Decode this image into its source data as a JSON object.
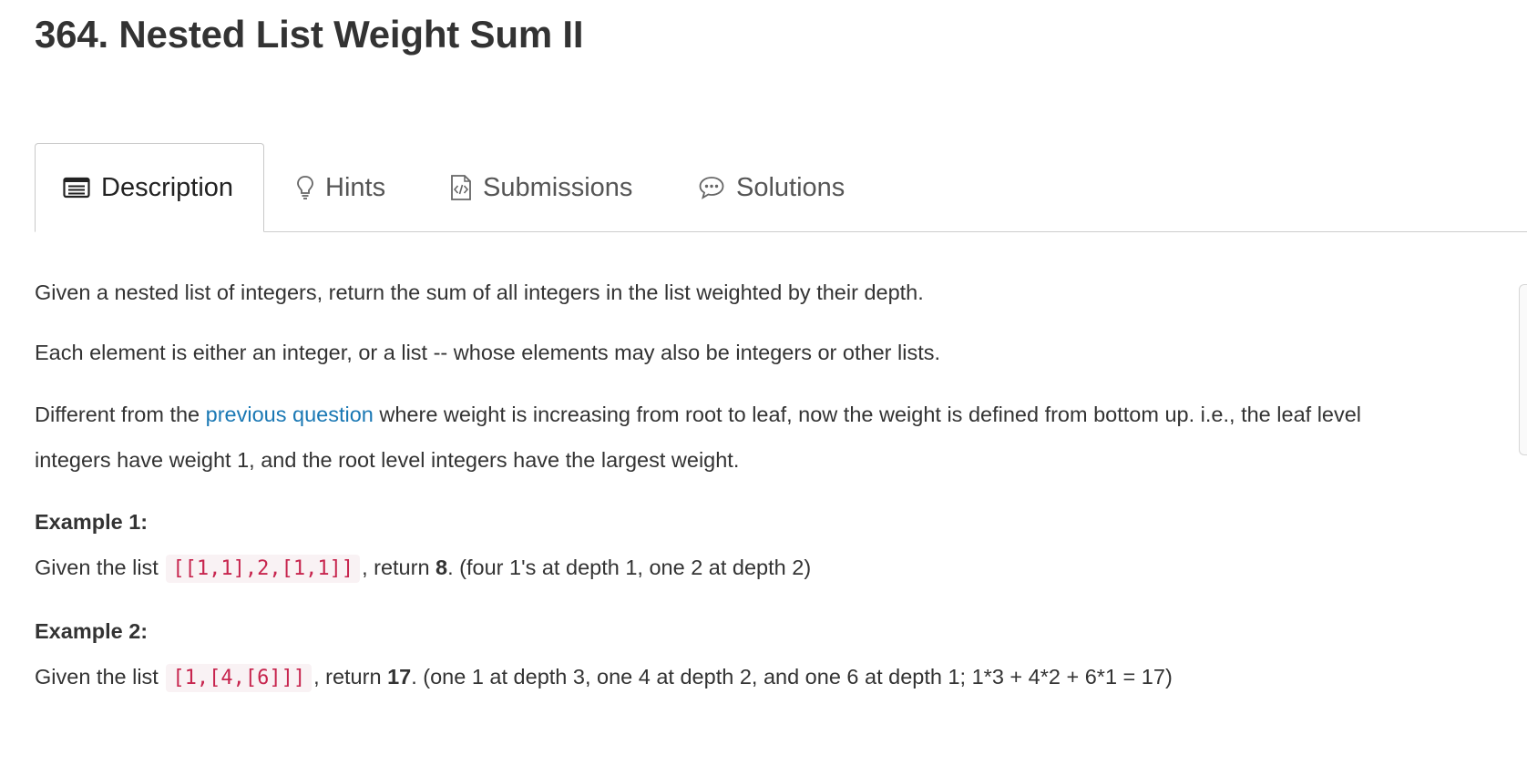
{
  "problem": {
    "title": "364. Nested List Weight Sum II"
  },
  "tabs": [
    {
      "label": "Description",
      "icon": "description-icon",
      "active": true
    },
    {
      "label": "Hints",
      "icon": "lightbulb-icon",
      "active": false
    },
    {
      "label": "Submissions",
      "icon": "code-file-icon",
      "active": false
    },
    {
      "label": "Solutions",
      "icon": "chat-bubble-icon",
      "active": false
    }
  ],
  "body": {
    "p1": "Given a nested list of integers, return the sum of all integers in the list weighted by their depth.",
    "p2": "Each element is either an integer, or a list -- whose elements may also be integers or other lists.",
    "p3_before_link": "Different from the ",
    "p3_link": "previous question",
    "p3_after_link": " where weight is increasing from root to leaf, now the weight is defined from bottom up. i.e., the leaf level",
    "p3_line2": "integers have weight 1, and the root level integers have the largest weight.",
    "example1": {
      "heading": "Example 1:",
      "prefix": "Given the list ",
      "code": "[[1,1],2,[1,1]]",
      "mid": ", return ",
      "answer": "8",
      "suffix": ". (four 1's at depth 1, one 2 at depth 2)"
    },
    "example2": {
      "heading": "Example 2:",
      "prefix": "Given the list ",
      "code": "[1,[4,[6]]]",
      "mid": ", return ",
      "answer": "17",
      "suffix": ". (one 1 at depth 3, one 4 at depth 2, and one 6 at depth 1; 1*3 + 4*2 + 6*1 = 17)"
    }
  },
  "colors": {
    "link": "#1a78b4",
    "code_text": "#c7254e",
    "code_bg": "#f9f2f4",
    "text": "#333333"
  }
}
